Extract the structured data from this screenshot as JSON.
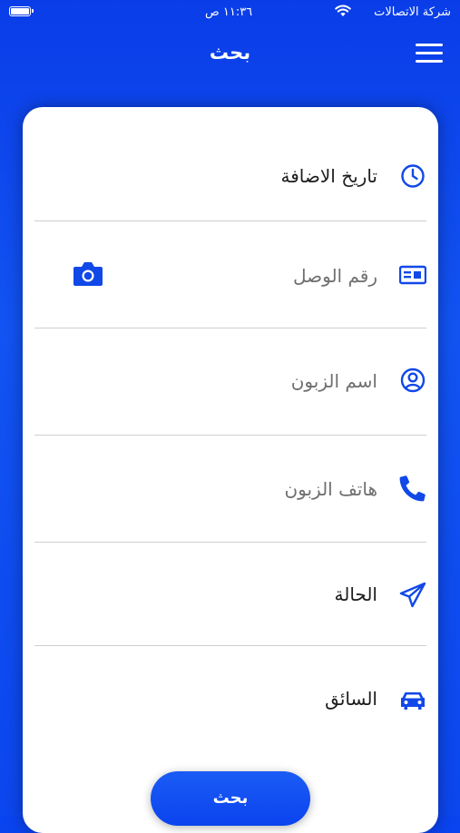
{
  "status_bar": {
    "carrier": "شركة الاتصالات",
    "time": "١١:٣٦ ص"
  },
  "nav": {
    "title": "بحث"
  },
  "form": {
    "fields": [
      {
        "label": "تاريخ الاضافة",
        "icon": "clock-icon",
        "is_placeholder": false
      },
      {
        "label": "رقم الوصل",
        "icon": "id-card-icon",
        "is_placeholder": true
      },
      {
        "label": "اسم الزبون",
        "icon": "user-circle-icon",
        "is_placeholder": true
      },
      {
        "label": "هاتف الزبون",
        "icon": "phone-icon",
        "is_placeholder": true
      },
      {
        "label": "الحالة",
        "icon": "paper-plane-icon",
        "is_placeholder": false
      },
      {
        "label": "السائق",
        "icon": "car-icon",
        "is_placeholder": false
      }
    ]
  },
  "search_button": {
    "label": "بحث"
  },
  "colors": {
    "accent": "#0A43F0",
    "icon": "#1148E8",
    "divider": "#CFCFCF"
  }
}
